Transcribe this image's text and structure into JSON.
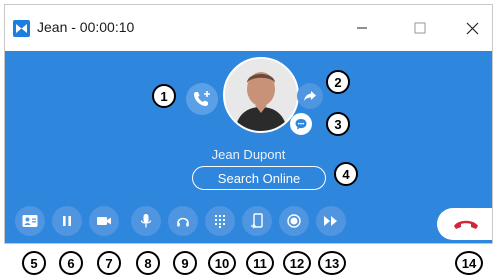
{
  "window": {
    "title": "Jean - 00:00:10",
    "icons": {
      "app": "app-logo-icon",
      "minimize": "minimize-icon",
      "maximize": "maximize-icon",
      "close": "close-icon"
    }
  },
  "call": {
    "contact_name": "Jean Dupont",
    "search_online_label": "Search Online",
    "icons": {
      "add_call": "add-call-icon",
      "share": "share-icon",
      "chat": "chat-icon"
    }
  },
  "toolbar": {
    "buttons": [
      {
        "icon": "contact-card-icon"
      },
      {
        "icon": "pause-icon"
      },
      {
        "icon": "video-icon"
      },
      {
        "icon": "microphone-icon"
      },
      {
        "icon": "headset-icon"
      },
      {
        "icon": "dialpad-icon"
      },
      {
        "icon": "transfer-phone-icon"
      },
      {
        "icon": "record-icon"
      },
      {
        "icon": "forward-icon"
      }
    ],
    "hangup_icon": "hangup-icon"
  },
  "callouts": [
    "1",
    "2",
    "3",
    "4",
    "5",
    "6",
    "7",
    "8",
    "9",
    "10",
    "11",
    "12",
    "13",
    "14"
  ],
  "colors": {
    "window_bg": "#2f86dd",
    "button_bg": "#4f95e0",
    "hangup_red": "#d4263a"
  }
}
